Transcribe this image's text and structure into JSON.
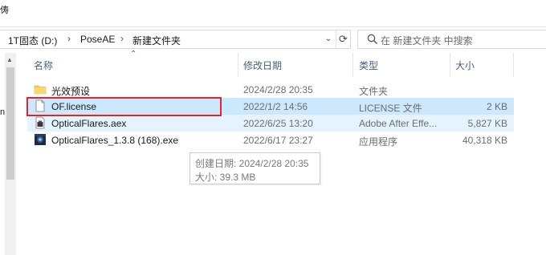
{
  "window": {
    "top_cut_char": "俦"
  },
  "breadcrumb": {
    "items": [
      "1T固态 (D:)",
      "PoseAE",
      "新建文件夹"
    ],
    "separator": "›"
  },
  "search": {
    "placeholder": "在 新建文件夹 中搜索"
  },
  "nav_pane": {
    "cut_char": "n"
  },
  "columns": {
    "name": "名称",
    "date": "修改日期",
    "type": "类型",
    "size": "大小"
  },
  "files": [
    {
      "name": "光效预设",
      "date": "2024/2/28 20:35",
      "type": "文件夹",
      "size": "",
      "icon": "folder-icon"
    },
    {
      "name": "OF.license",
      "date": "2022/1/2 14:56",
      "type": "LICENSE 文件",
      "size": "2 KB",
      "icon": "blank-file-icon"
    },
    {
      "name": "OpticalFlares.aex",
      "date": "2022/6/25 13:20",
      "type": "Adobe After Effe...",
      "size": "5,827 KB",
      "icon": "aex-file-icon"
    },
    {
      "name": "OpticalFlares_1.3.8 (168).exe",
      "date": "2022/6/17 23:27",
      "type": "应用程序",
      "size": "40,318 KB",
      "icon": "exe-file-icon"
    }
  ],
  "tooltip": {
    "created": "创建日期: 2024/2/28 20:35",
    "size": "大小: 39.3 MB"
  },
  "colors": {
    "highlight_border": "#e0262b",
    "selected_row": "#cce8ff",
    "hover_row": "#e5f3ff",
    "folder": "#f3c74f"
  }
}
